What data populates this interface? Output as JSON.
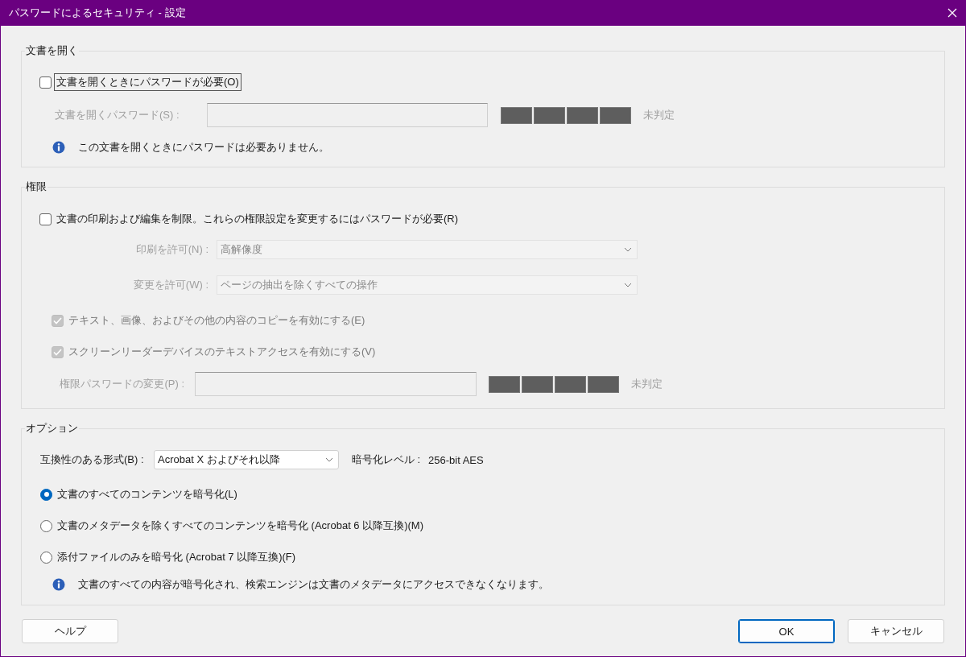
{
  "window": {
    "title": "パスワードによるセキュリティ - 設定"
  },
  "open_section": {
    "title": "文書を開く",
    "require_checkbox": {
      "label": "文書を開くときにパスワードが必要(O)",
      "checked": false,
      "focused": true
    },
    "password_field": {
      "label": "文書を開くパスワード(S) :",
      "disabled": true
    },
    "strength": {
      "label": "未判定"
    },
    "info": "この文書を開くときにパスワードは必要ありません。"
  },
  "permissions_section": {
    "title": "権限",
    "restrict_checkbox": {
      "label": "文書の印刷および編集を制限。これらの権限設定を変更するにはパスワードが必要(R)",
      "checked": false
    },
    "print_select": {
      "label": "印刷を許可(N) :",
      "value": "高解像度",
      "disabled": true
    },
    "change_select": {
      "label": "変更を許可(W) :",
      "value": "ページの抽出を除くすべての操作",
      "disabled": true
    },
    "checkboxes": [
      {
        "label": "テキスト、画像、およびその他の内容のコピーを有効にする(E)",
        "checked": true,
        "disabled": true
      },
      {
        "label": "スクリーンリーダーデバイスのテキストアクセスを有効にする(V)",
        "checked": true,
        "disabled": true
      }
    ],
    "password_field": {
      "label": "権限パスワードの変更(P) :",
      "disabled": true
    },
    "strength": {
      "label": "未判定"
    }
  },
  "options_section": {
    "title": "オプション",
    "compat_select": {
      "label": "互換性のある形式(B) :",
      "value": "Acrobat X およびそれ以降"
    },
    "encryption_level": {
      "label": "暗号化レベル :",
      "value": "256-bit AES"
    },
    "encrypt_options": [
      {
        "label": "文書のすべてのコンテンツを暗号化(L)",
        "selected": true
      },
      {
        "label": "文書のメタデータを除くすべてのコンテンツを暗号化 (Acrobat 6 以降互換)(M)",
        "selected": false
      },
      {
        "label": "添付ファイルのみを暗号化 (Acrobat 7 以降互換)(F)",
        "selected": false
      }
    ],
    "info": "文書のすべての内容が暗号化され、検索エンジンは文書のメタデータにアクセスできなくなります。"
  },
  "help_button": {
    "label": "ヘルプ"
  },
  "buttons": [
    {
      "label": "OK",
      "default": true
    },
    {
      "label": "キャンセル",
      "default": false
    }
  ]
}
